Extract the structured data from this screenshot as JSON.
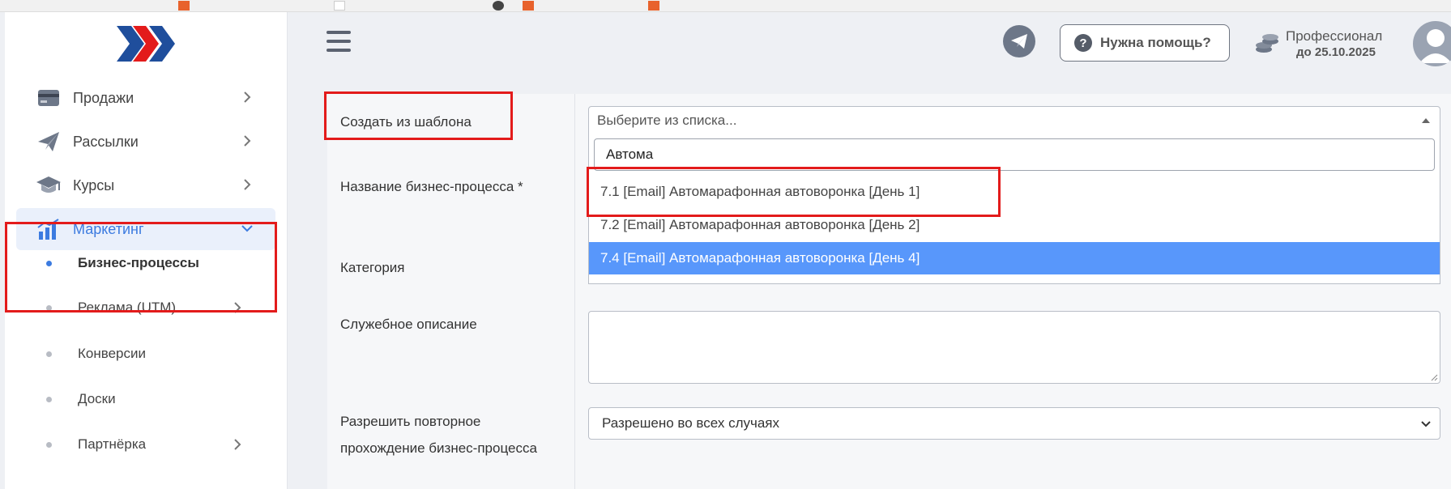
{
  "sidebar": {
    "items": [
      {
        "label": "Продажи",
        "icon": "card-icon"
      },
      {
        "label": "Рассылки",
        "icon": "paper-plane-icon"
      },
      {
        "label": "Курсы",
        "icon": "graduation-cap-icon"
      },
      {
        "label": "Маркетинг",
        "icon": "chart-icon"
      }
    ],
    "sub_items": [
      {
        "label": "Бизнес-процессы"
      },
      {
        "label": "Реклама (UTM)"
      },
      {
        "label": "Конверсии"
      },
      {
        "label": "Доски"
      },
      {
        "label": "Партнёрка"
      }
    ]
  },
  "header": {
    "help_label": "Нужна помощь?",
    "plan_name": "Профессионал",
    "plan_until": "до 25.10.2025"
  },
  "form": {
    "template_label": "Создать из шаблона",
    "template_placeholder": "Выберите из списка...",
    "name_label": "Название бизнес-процесса *",
    "category_label": "Категория",
    "description_label": "Служебное описание",
    "repeat_label": "Разрешить повторное прохождение бизнес-процесса",
    "repeat_value": "Разрешено во всех случаях"
  },
  "dropdown": {
    "search_value": "Автома",
    "options": [
      "7.1 [Email] Автомарафонная автоворонка [День 1]",
      "7.2 [Email] Автомарафонная автоворонка [День 2]",
      "7.4 [Email] Автомарафонная автоворонка [День 4]"
    ],
    "highlighted_index": 2
  },
  "colors": {
    "accent": "#3c7be0",
    "highlight": "#5897fb",
    "annotation": "#e31b1b"
  }
}
